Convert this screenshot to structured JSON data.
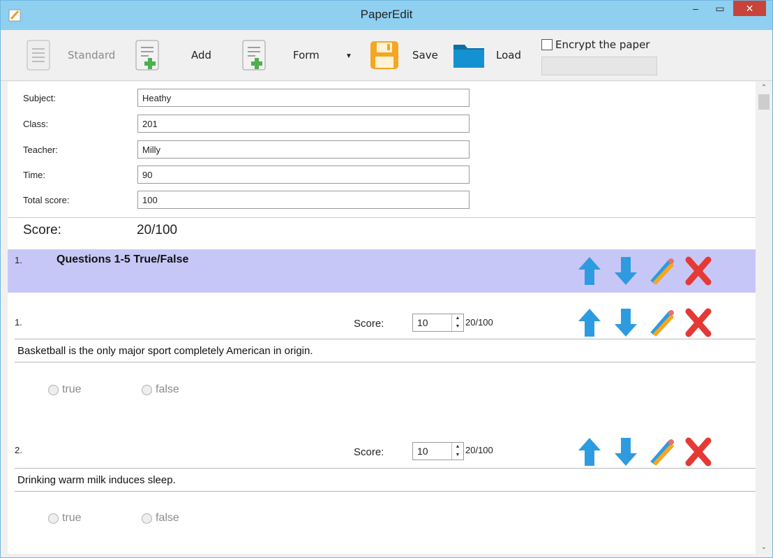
{
  "window": {
    "title": "PaperEdit"
  },
  "toolbar": {
    "standard_label": "Standard",
    "add_label": "Add",
    "form_label": "Form",
    "save_label": "Save",
    "load_label": "Load",
    "encrypt_label": "Encrypt the paper"
  },
  "fields": [
    {
      "label": "Subject:",
      "value": "Heathy"
    },
    {
      "label": "Class:",
      "value": "201"
    },
    {
      "label": "Teacher:",
      "value": "Milly"
    },
    {
      "label": "Time:",
      "value": "90"
    },
    {
      "label": "Total score:",
      "value": "100"
    }
  ],
  "score": {
    "label": "Score:",
    "value": "20/100"
  },
  "section": {
    "number": "1.",
    "title": "Questions 1-5 True/False"
  },
  "questions": [
    {
      "number": "1.",
      "score_label": "Score:",
      "score_value": "10",
      "fraction": "20/100",
      "text": "Basketball is the only major sport completely American in origin.",
      "options": [
        "true",
        "false"
      ]
    },
    {
      "number": "2.",
      "score_label": "Score:",
      "score_value": "10",
      "fraction": "20/100",
      "text": "Drinking warm milk induces sleep.",
      "options": [
        "true",
        "false"
      ]
    }
  ],
  "colors": {
    "titlebar": "#8fd0f0",
    "section_band": "#c7c7f7",
    "arrow": "#2e9be0",
    "delete": "#e53935"
  }
}
